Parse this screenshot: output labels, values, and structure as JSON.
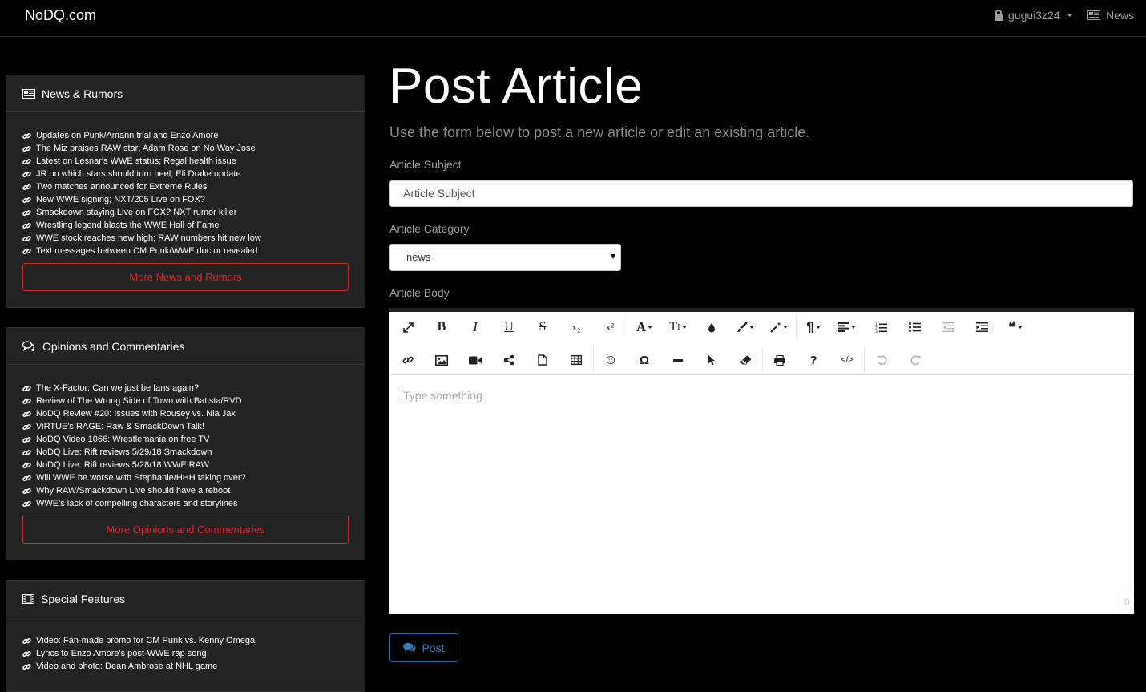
{
  "navbar": {
    "brand": "NoDQ.com",
    "user": "gugui3z24",
    "news_label": "News"
  },
  "sidebar": {
    "news": {
      "title": "News & Rumors",
      "items": [
        "Updates on Punk/Amann trial and Enzo Amore",
        "The Miz praises RAW star; Adam Rose on No Way Jose",
        "Latest on Lesnar's WWE status; Regal health issue",
        "JR on which stars should turn heel; Eli Drake update",
        "Two matches announced for Extreme Rules",
        "New WWE signing; NXT/205 Live on FOX?",
        "Smackdown staying Live on FOX? NXT rumor killer",
        "Wrestling legend blasts the WWE Hall of Fame",
        "WWE stock reaches new high; RAW numbers hit new low",
        "Text messages between CM Punk/WWE doctor revealed"
      ],
      "more_label": "More News and Rumors"
    },
    "opinions": {
      "title": "Opinions and Commentaries",
      "items": [
        "The X-Factor: Can we just be fans again?",
        "Review of The Wrong Side of Town with Batista/RVD",
        "NoDQ Review #20: Issues with Rousey vs. Nia Jax",
        "ViRTUE's RAGE: Raw & SmackDown Talk!",
        "NoDQ Video 1066: Wrestlemania on free TV",
        "NoDQ Live: Rift reviews 5/29/18 Smackdown",
        "NoDQ Live: Rift reviews 5/28/18 WWE RAW",
        "Will WWE be worse with Stephanie/HHH taking over?",
        "Why RAW/Smackdown Live should have a reboot",
        "WWE's lack of compelling characters and storylines"
      ],
      "more_label": "More Opinions and Commentaries"
    },
    "features": {
      "title": "Special Features",
      "items": [
        "Video: Fan-made promo for CM Punk vs. Kenny Omega",
        "Lyrics to Enzo Amore's post-WWE rap song",
        "Video and photo: Dean Ambrose at NHL game"
      ]
    }
  },
  "main": {
    "title": "Post Article",
    "lead": "Use the form below to post a new article or edit an existing article.",
    "subject_label": "Article Subject",
    "subject_placeholder": "Article Subject",
    "category_label": "Article Category",
    "category_value": "news",
    "body_label": "Article Body",
    "editor_placeholder": "Type something",
    "char_count": "0",
    "post_label": "Post"
  },
  "toolbar": {
    "bold": "B",
    "italic": "I",
    "underline": "U",
    "strike": "S",
    "subscript": "x₂",
    "superscript": "x²",
    "font_family": "A",
    "font_size": "T",
    "paragraph": "¶",
    "quote": "❝",
    "emoji": "☺",
    "special_chars": "Ω",
    "help": "?",
    "code_view": "</>"
  },
  "colors": {
    "background": "#000000",
    "panel": "#232323",
    "danger": "#d9262b",
    "primary": "#337ab7"
  }
}
